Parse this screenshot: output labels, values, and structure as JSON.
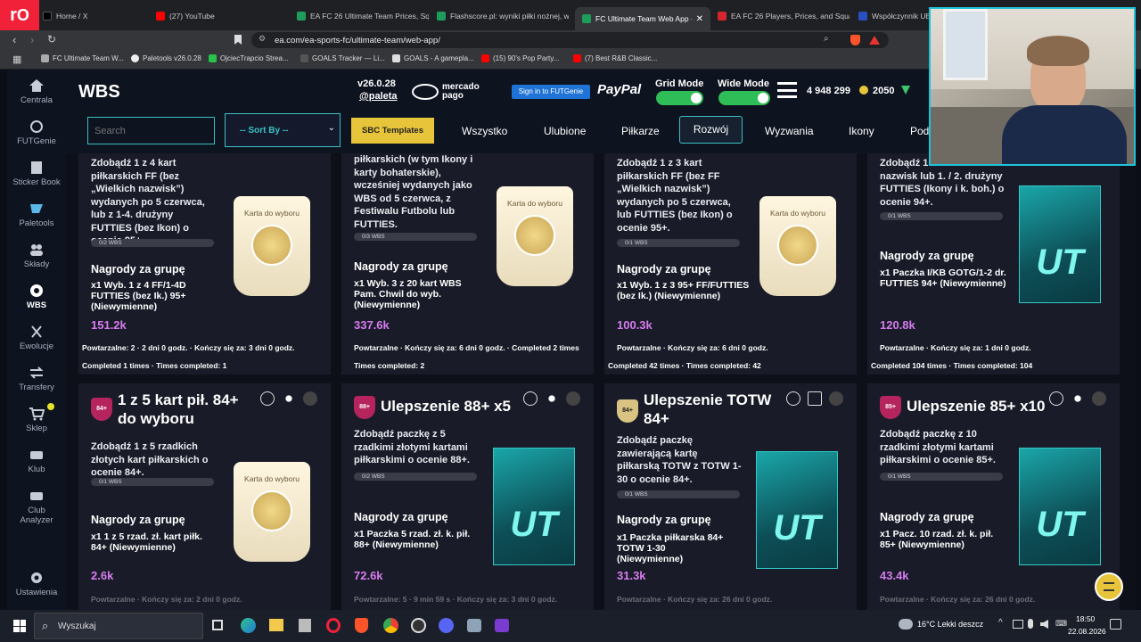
{
  "browser": {
    "tabs": [
      {
        "label": "Home / X",
        "color": "#000000"
      },
      {
        "label": "(27) YouTube",
        "color": "#ff0000"
      },
      {
        "label": "EA FC 26 Ultimate Team Prices, Squ",
        "color": "#1d9d5a"
      },
      {
        "label": "Flashscore.pl: wyniki piłki nożnej, w",
        "color": "#1d9d5a"
      },
      {
        "label": "FC Ultimate Team Web App - E",
        "color": "#1d9d5a"
      },
      {
        "label": "EA FC 26 Players, Prices, and Squad",
        "color": "#d6262d"
      },
      {
        "label": "Współczynnik UE",
        "color": "#2a4fc0"
      }
    ],
    "url": "ea.com/ea-sports-fc/ultimate-team/web-app/",
    "bookmarks": [
      "FC Ultimate Team W...",
      "Paletools v26.0.28",
      "OjciecTrapcio Strea...",
      "GOALS Tracker — Li...",
      "GOALS - A gamepla...",
      "(15) 90's Pop Party...",
      "(7) Best R&B Classic..."
    ]
  },
  "sidebar": {
    "items": [
      "Centrala",
      "FUTGenie",
      "Sticker Book",
      "Paletools",
      "Składy",
      "WBS",
      "Ewolucje",
      "Transfery",
      "Sklep",
      "Klub",
      "Club Analyzer",
      "Ustawienia"
    ]
  },
  "header": {
    "title": "WBS",
    "version": "v26.0.28",
    "handle": "@paleta",
    "mercado": "mercado pago",
    "futgenie": "Sign in to FUTGenie",
    "paypal": "PayPal",
    "grid_mode": "Grid Mode",
    "wide_mode": "Wide Mode",
    "coins": "4 948 299",
    "points": "2050"
  },
  "filters": {
    "search_placeholder": "Search",
    "sort": "-- Sort By --",
    "sbc_templates": "SBC Templates",
    "tabs": [
      "Wszystko",
      "Ulubione",
      "Piłkarze",
      "Rozwój",
      "Wyzwania",
      "Ikony",
      "Pod"
    ],
    "active_tab": "Rozwój"
  },
  "row1": [
    {
      "desc": "Zdobądź 1 z 4 kart piłkarskich FF (bez „Wielkich nazwisk”) wydanych po 5 czerwca, lub z 1-4. drużyny FUTTIES (bez Ikon) o ocenie 95+.",
      "progress": "0/2 WBS",
      "reward_title": "Nagrody za grupę",
      "reward": "x1 Wyb. 1 z 4 FF/1-4D FUTTIES (bez Ik.) 95+ (Niewymienne)",
      "price": "151.2k",
      "pick": "Karta do wyboru",
      "foot1": "Powtarzalne: 2 · 2 dni 0 godz. · Kończy się za: 3 dni 0 godz.",
      "foot2": "Completed 1 times · Times completed: 1"
    },
    {
      "desc": "piłkarskich (w tym Ikony i karty bohaterskie), wcześniej wydanych jako WBS od 5 czerwca, z Festiwalu Futbolu lub FUTTIES.",
      "progress": "0/3 WBS",
      "reward_title": "Nagrody za grupę",
      "reward": "x1 Wyb. 3 z 20 kart WBS Pam. Chwil do wyb. (Niewymienne)",
      "price": "337.6k",
      "pick": "Karta do wyboru",
      "foot1": "Powtarzalne · Kończy się za: 6 dni 0 godz. · Completed 2 times",
      "foot2": "Times completed: 2"
    },
    {
      "desc": "Zdobądź 1 z 3 kart piłkarskich FF (bez FF „Wielkich nazwisk”) wydanych po 5 czerwca, lub FUTTIES (bez Ikon) o ocenie 95+.",
      "progress": "0/1 WBS",
      "reward_title": "Nagrody za grupę",
      "reward": "x1 Wyb. 1 z 3 95+ FF/FUTTIES (bez Ik.) (Niewymienne)",
      "price": "100.3k",
      "pick": "Karta do wyboru",
      "foot1": "Powtarzalne · Kończy się za: 6 dni 0 godz.",
      "foot2": "Completed 42 times · Times completed: 42"
    },
    {
      "desc": "Zdobądź 1 FF: Wielkich nazwisk lub 1. / 2. drużyny FUTTIES (Ikony i k. boh.) o ocenie 94+.",
      "progress": "0/1 WBS",
      "reward_title": "Nagrody za grupę",
      "reward": "x1 Paczka I/KB GOTG/1-2 dr. FUTTIES 94+ (Niewymienne)",
      "price": "120.8k",
      "foot1": "Powtarzalne · Kończy się za: 1 dni 0 godz.",
      "foot2": "Completed 104 times · Times completed: 104"
    }
  ],
  "row2": [
    {
      "title": "1 z 5 kart pił. 84+ do wyboru",
      "badge": "84+",
      "desc": "Zdobądź 1 z 5 rzadkich złotych kart piłkarskich o ocenie 84+.",
      "progress": "0/1 WBS",
      "reward_title": "Nagrody za grupę",
      "reward": "x1 1 z 5 rzad. zł. kart piłk. 84+ (Niewymienne)",
      "price": "2.6k",
      "pick": "Karta do wyboru",
      "foot": "Powtarzalne · Kończy się za: 2 dni 0 godz."
    },
    {
      "title": "Ulepszenie 88+ x5",
      "badge": "88+",
      "desc": "Zdobądź paczkę z 5 rzadkimi złotymi kartami piłkarskimi o ocenie 88+.",
      "progress": "0/2 WBS",
      "reward_title": "Nagrody za grupę",
      "reward": "x1 Paczka 5 rzad. zł. k. pił. 88+ (Niewymienne)",
      "price": "72.6k",
      "foot": "Powtarzalne: 5 · 9 min 59 s · Kończy się za: 3 dni 0 godz."
    },
    {
      "title": "Ulepszenie TOTW 84+",
      "badge": "84+",
      "desc": "Zdobądź paczkę zawierającą kartę piłkarską TOTW z TOTW 1-30 o ocenie 84+.",
      "progress": "0/1 WBS",
      "reward_title": "Nagrody za grupę",
      "reward": "x1 Paczka piłkarska 84+ TOTW 1-30 (Niewymienne)",
      "price": "31.3k",
      "foot": "Powtarzalne · Kończy się za: 26 dni 0 godz."
    },
    {
      "title": "Ulepszenie 85+ x10",
      "badge": "85+",
      "desc": "Zdobądź paczkę z 10 rzadkimi złotymi kartami piłkarskimi o ocenie 85+.",
      "progress": "0/1 WBS",
      "reward_title": "Nagrody za grupę",
      "reward": "x1 Pacz. 10 rzad. zł. k. pił. 85+ (Niewymienne)",
      "price": "43.4k",
      "foot": "Powtarzalne · Kończy się za: 26 dni 0 godz."
    }
  ],
  "pack_label": "UT",
  "taskbar": {
    "search": "Wyszukaj",
    "weather": "16°C  Lekki deszcz",
    "time": "18:50",
    "date": "22.08.2026"
  },
  "colors": {
    "accent": "#d77cf0",
    "progress_bg": "#3a3d48",
    "sbc_button": "#e7c43a",
    "input_border": "#3bc0c5"
  }
}
